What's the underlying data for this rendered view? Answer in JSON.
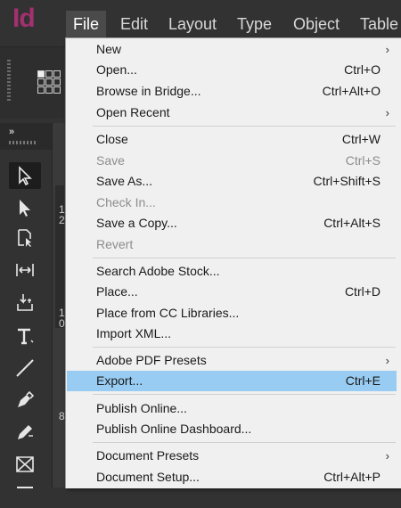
{
  "app": {
    "logo": "Id"
  },
  "menubar": [
    "File",
    "Edit",
    "Layout",
    "Type",
    "Object",
    "Table"
  ],
  "tools_panel": {
    "collapse": "»"
  },
  "doc_marks": [
    "1",
    "2",
    "1",
    "0",
    "8"
  ],
  "file_menu": [
    {
      "label": "New",
      "shortcut": "",
      "submenu": true,
      "disabled": false
    },
    {
      "label": "Open...",
      "shortcut": "Ctrl+O",
      "submenu": false,
      "disabled": false
    },
    {
      "label": "Browse in Bridge...",
      "shortcut": "Ctrl+Alt+O",
      "submenu": false,
      "disabled": false
    },
    {
      "label": "Open Recent",
      "shortcut": "",
      "submenu": true,
      "disabled": false
    },
    {
      "label": "Close",
      "shortcut": "Ctrl+W",
      "submenu": false,
      "disabled": false
    },
    {
      "label": "Save",
      "shortcut": "Ctrl+S",
      "submenu": false,
      "disabled": true
    },
    {
      "label": "Save As...",
      "shortcut": "Ctrl+Shift+S",
      "submenu": false,
      "disabled": false
    },
    {
      "label": "Check In...",
      "shortcut": "",
      "submenu": false,
      "disabled": true
    },
    {
      "label": "Save a Copy...",
      "shortcut": "Ctrl+Alt+S",
      "submenu": false,
      "disabled": false
    },
    {
      "label": "Revert",
      "shortcut": "",
      "submenu": false,
      "disabled": true
    },
    {
      "label": "Search Adobe Stock...",
      "shortcut": "",
      "submenu": false,
      "disabled": false
    },
    {
      "label": "Place...",
      "shortcut": "Ctrl+D",
      "submenu": false,
      "disabled": false
    },
    {
      "label": "Place from CC Libraries...",
      "shortcut": "",
      "submenu": false,
      "disabled": false
    },
    {
      "label": "Import XML...",
      "shortcut": "",
      "submenu": false,
      "disabled": false
    },
    {
      "label": "Adobe PDF Presets",
      "shortcut": "",
      "submenu": true,
      "disabled": false
    },
    {
      "label": "Export...",
      "shortcut": "Ctrl+E",
      "submenu": false,
      "disabled": false,
      "highlighted": true
    },
    {
      "label": "Publish Online...",
      "shortcut": "",
      "submenu": false,
      "disabled": false
    },
    {
      "label": "Publish Online Dashboard...",
      "shortcut": "",
      "submenu": false,
      "disabled": false
    },
    {
      "label": "Document Presets",
      "shortcut": "",
      "submenu": true,
      "disabled": false
    },
    {
      "label": "Document Setup...",
      "shortcut": "Ctrl+Alt+P",
      "submenu": false,
      "disabled": false
    }
  ],
  "submenu_arrow": "›",
  "colors": {
    "logo": "#a3306f",
    "highlight": "#99ccf2",
    "menu_bg": "#f0f0f0",
    "chrome": "#323232"
  }
}
